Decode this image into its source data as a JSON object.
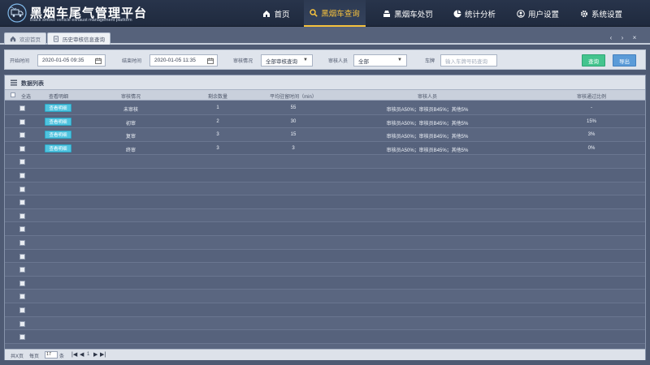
{
  "header": {
    "title": "黑烟车尾气管理平台",
    "subtitle": "Black smoke vehicle exhaust management platform",
    "nav": [
      {
        "label": "首页",
        "icon": "home-icon"
      },
      {
        "label": "黑烟车查询",
        "icon": "search-icon",
        "active": true
      },
      {
        "label": "黑烟车处罚",
        "icon": "penalty-icon"
      },
      {
        "label": "统计分析",
        "icon": "pie-chart-icon"
      },
      {
        "label": "用户设置",
        "icon": "user-icon"
      },
      {
        "label": "系统设置",
        "icon": "gear-icon"
      }
    ],
    "accent_color": "#f6c23e"
  },
  "tabs": [
    {
      "label": "欢迎首页",
      "icon": "home-icon",
      "active": false
    },
    {
      "label": "历史审核信息查询",
      "icon": "document-icon",
      "active": true
    }
  ],
  "tab_controls": [
    "‹",
    "›",
    "×"
  ],
  "filters": {
    "start_label": "开始时间",
    "start_value": "2020-01-05 09:35",
    "end_label": "结束时间",
    "end_value": "2020-01-05 11:35",
    "status_label": "审核情况",
    "status_value": "全部审核查询",
    "reviewer_label": "审核人员",
    "reviewer_value": "全部",
    "plate_label": "车牌",
    "plate_placeholder": "输入车牌号码查询",
    "query_button": "查询",
    "export_button": "导出"
  },
  "table": {
    "title": "数据列表",
    "headers": [
      "全选",
      "查看明细",
      "审核情况",
      "剩余数量",
      "平均驻留时间（min）",
      "审核人员",
      "审核通过比例"
    ],
    "view_label": "查看明细",
    "rows": [
      {
        "status": "未审核",
        "remaining": "1",
        "avg_time": "55",
        "reviewers": "审核员A50%；审核员B45%；其他5%",
        "ratio": "-"
      },
      {
        "status": "初审",
        "remaining": "2",
        "avg_time": "30",
        "reviewers": "审核员A50%；审核员B45%；其他5%",
        "ratio": "15%"
      },
      {
        "status": "复审",
        "remaining": "3",
        "avg_time": "15",
        "reviewers": "审核员A50%；审核员B45%；其他5%",
        "ratio": "3%"
      },
      {
        "status": "终审",
        "remaining": "3",
        "avg_time": "3",
        "reviewers": "审核员A50%；审核员B45%；其他5%",
        "ratio": "0%"
      }
    ],
    "empty_rows": 14
  },
  "pager": {
    "total_label": "共X页",
    "per_page_label": "每页",
    "per_page_value": "17",
    "per_page_unit": "条",
    "first": "|◀",
    "prev": "◀",
    "page": "1",
    "next": "▶",
    "last": "▶|"
  }
}
